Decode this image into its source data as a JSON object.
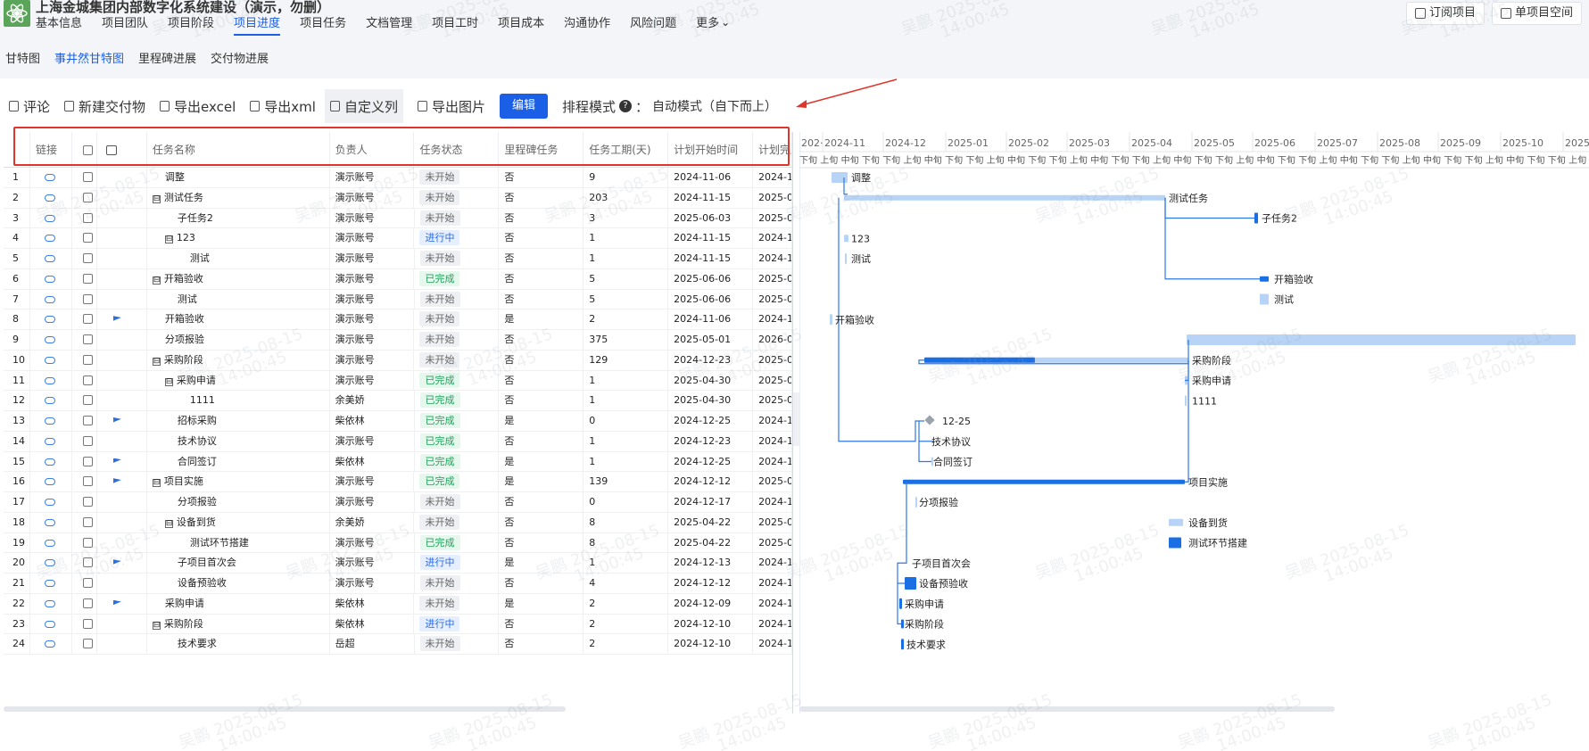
{
  "header": {
    "project_title": "上海金城集团内部数字化系统建设（演示，勿删）",
    "nav": [
      "基本信息",
      "项目团队",
      "项目阶段",
      "项目进度",
      "项目任务",
      "文档管理",
      "项目工时",
      "项目成本",
      "沟通协作",
      "风险问题",
      "更多"
    ],
    "active_nav": "项目进度",
    "subscribe_label": "订阅项目",
    "space_label": "单项目空间"
  },
  "subnav": [
    "甘特图",
    "事井然甘特图",
    "里程碑进展",
    "交付物进展"
  ],
  "toolbar": {
    "comment": "评论",
    "new_deliverable": "新建交付物",
    "export_excel": "导出excel",
    "export_xml": "导出xml",
    "custom_columns": "自定义列",
    "export_image": "导出图片",
    "edit": "编辑",
    "schedule_mode_label": "排程模式",
    "schedule_mode_sep": "：",
    "schedule_mode_value": "自动模式（自下而上）"
  },
  "grid": {
    "columns": [
      "链接",
      "",
      "",
      "任务名称",
      "负责人",
      "任务状态",
      "里程碑任务",
      "任务工期(天)",
      "计划开始时间",
      "计划完成"
    ],
    "rows": [
      {
        "no": "1",
        "name": "调整",
        "indent": 1,
        "expander": "",
        "flag": false,
        "owner": "演示账号",
        "status": "未开始",
        "milestone": "否",
        "duration": "9",
        "start": "2024-11-06",
        "end": "2024-1"
      },
      {
        "no": "2",
        "name": "测试任务",
        "indent": 0,
        "expander": "⊟",
        "flag": false,
        "owner": "演示账号",
        "status": "未开始",
        "milestone": "否",
        "duration": "203",
        "start": "2024-11-15",
        "end": "2025-0"
      },
      {
        "no": "3",
        "name": "子任务2",
        "indent": 2,
        "expander": "",
        "flag": false,
        "owner": "演示账号",
        "status": "未开始",
        "milestone": "否",
        "duration": "3",
        "start": "2025-06-03",
        "end": "2025-0"
      },
      {
        "no": "4",
        "name": "123",
        "indent": 1,
        "expander": "⊟",
        "flag": false,
        "owner": "演示账号",
        "status": "进行中",
        "milestone": "否",
        "duration": "1",
        "start": "2024-11-15",
        "end": "2024-1"
      },
      {
        "no": "5",
        "name": "测试",
        "indent": 3,
        "expander": "",
        "flag": false,
        "owner": "演示账号",
        "status": "未开始",
        "milestone": "否",
        "duration": "1",
        "start": "2024-11-15",
        "end": "2024-1"
      },
      {
        "no": "6",
        "name": "开箱验收",
        "indent": 0,
        "expander": "⊟",
        "flag": false,
        "owner": "演示账号",
        "status": "已完成",
        "milestone": "否",
        "duration": "5",
        "start": "2025-06-06",
        "end": "2025-0"
      },
      {
        "no": "7",
        "name": "测试",
        "indent": 2,
        "expander": "",
        "flag": false,
        "owner": "演示账号",
        "status": "未开始",
        "milestone": "否",
        "duration": "5",
        "start": "2025-06-06",
        "end": "2025-0"
      },
      {
        "no": "8",
        "name": "开箱验收",
        "indent": 1,
        "expander": "",
        "flag": true,
        "owner": "演示账号",
        "status": "未开始",
        "milestone": "是",
        "duration": "2",
        "start": "2024-11-06",
        "end": "2024-1"
      },
      {
        "no": "9",
        "name": "分项报验",
        "indent": 1,
        "expander": "",
        "flag": false,
        "owner": "演示账号",
        "status": "未开始",
        "milestone": "否",
        "duration": "375",
        "start": "2025-05-01",
        "end": "2026-0"
      },
      {
        "no": "10",
        "name": "采购阶段",
        "indent": 0,
        "expander": "⊟",
        "flag": false,
        "owner": "演示账号",
        "status": "未开始",
        "milestone": "否",
        "duration": "129",
        "start": "2024-12-23",
        "end": "2025-0"
      },
      {
        "no": "11",
        "name": "采购申请",
        "indent": 1,
        "expander": "⊟",
        "flag": false,
        "owner": "演示账号",
        "status": "已完成",
        "milestone": "否",
        "duration": "1",
        "start": "2025-04-30",
        "end": "2025-0"
      },
      {
        "no": "12",
        "name": "1111",
        "indent": 3,
        "expander": "",
        "flag": false,
        "owner": "余美娇",
        "status": "已完成",
        "milestone": "否",
        "duration": "1",
        "start": "2025-04-30",
        "end": "2025-0"
      },
      {
        "no": "13",
        "name": "招标采购",
        "indent": 2,
        "expander": "",
        "flag": true,
        "owner": "柴依林",
        "status": "已完成",
        "milestone": "是",
        "duration": "0",
        "start": "2024-12-25",
        "end": "2024-1"
      },
      {
        "no": "14",
        "name": "技术协议",
        "indent": 2,
        "expander": "",
        "flag": false,
        "owner": "演示账号",
        "status": "已完成",
        "milestone": "否",
        "duration": "1",
        "start": "2024-12-23",
        "end": "2024-1"
      },
      {
        "no": "15",
        "name": "合同签订",
        "indent": 2,
        "expander": "",
        "flag": true,
        "owner": "柴依林",
        "status": "已完成",
        "milestone": "是",
        "duration": "1",
        "start": "2024-12-25",
        "end": "2024-1"
      },
      {
        "no": "16",
        "name": "项目实施",
        "indent": 0,
        "expander": "⊟",
        "flag": true,
        "owner": "演示账号",
        "status": "已完成",
        "milestone": "是",
        "duration": "139",
        "start": "2024-12-12",
        "end": "2025-0"
      },
      {
        "no": "17",
        "name": "分项报验",
        "indent": 2,
        "expander": "",
        "flag": false,
        "owner": "演示账号",
        "status": "未开始",
        "milestone": "否",
        "duration": "0",
        "start": "2024-12-17",
        "end": "2024-1"
      },
      {
        "no": "18",
        "name": "设备到货",
        "indent": 1,
        "expander": "⊟",
        "flag": false,
        "owner": "余美娇",
        "status": "未开始",
        "milestone": "否",
        "duration": "8",
        "start": "2025-04-22",
        "end": "2025-0"
      },
      {
        "no": "19",
        "name": "测试环节搭建",
        "indent": 3,
        "expander": "",
        "flag": false,
        "owner": "演示账号",
        "status": "已完成",
        "milestone": "否",
        "duration": "8",
        "start": "2025-04-22",
        "end": "2025-0"
      },
      {
        "no": "20",
        "name": "子项目首次会",
        "indent": 2,
        "expander": "",
        "flag": true,
        "owner": "演示账号",
        "status": "进行中",
        "milestone": "是",
        "duration": "1",
        "start": "2024-12-13",
        "end": "2024-1"
      },
      {
        "no": "21",
        "name": "设备预验收",
        "indent": 2,
        "expander": "",
        "flag": false,
        "owner": "演示账号",
        "status": "未开始",
        "milestone": "否",
        "duration": "4",
        "start": "2024-12-12",
        "end": "2024-1"
      },
      {
        "no": "22",
        "name": "采购申请",
        "indent": 1,
        "expander": "",
        "flag": true,
        "owner": "柴依林",
        "status": "未开始",
        "milestone": "是",
        "duration": "2",
        "start": "2024-12-09",
        "end": "2024-1"
      },
      {
        "no": "23",
        "name": "采购阶段",
        "indent": 0,
        "expander": "⊟",
        "flag": false,
        "owner": "柴依林",
        "status": "进行中",
        "milestone": "否",
        "duration": "2",
        "start": "2024-12-10",
        "end": "2024-1"
      },
      {
        "no": "24",
        "name": "技术要求",
        "indent": 2,
        "expander": "",
        "flag": false,
        "owner": "岳超",
        "status": "未开始",
        "milestone": "否",
        "duration": "2",
        "start": "2024-12-10",
        "end": "2024-1"
      }
    ]
  },
  "gantt": {
    "months": [
      "202·",
      "2024-11",
      "2024-12",
      "2025-01",
      "2025-02",
      "2025-03",
      "2025-04",
      "2025-05",
      "2025-06",
      "2025-07",
      "2025-08",
      "2025-09",
      "2025-10",
      "2025-"
    ],
    "decades": [
      "下旬",
      "上旬",
      "中旬",
      "下旬"
    ],
    "labels": [
      "调整",
      "测试任务",
      "子任务2",
      "123",
      "测试",
      "开箱验收",
      "测试",
      "开箱验收",
      "",
      "采购阶段",
      "采购申请",
      "1111",
      "12-25",
      "技术协议",
      "合同签订",
      "项目实施",
      "分项报验",
      "设备到货",
      "测试环节搭建",
      "子项目首次会",
      "设备预验收",
      "采购申请",
      "采购阶段",
      "技术要求"
    ],
    "colors": {
      "bar_light": "#b7d3f5",
      "bar_dark": "#1b6fe4",
      "line": "#2e78e6",
      "milestone": "#9aa3ad"
    }
  },
  "status_colors": {
    "未开始": "st-todo",
    "进行中": "st-doing",
    "已完成": "st-done"
  },
  "watermark": {
    "name": "吴鹏",
    "date": "2025-08-15",
    "time": "14:00:45"
  }
}
